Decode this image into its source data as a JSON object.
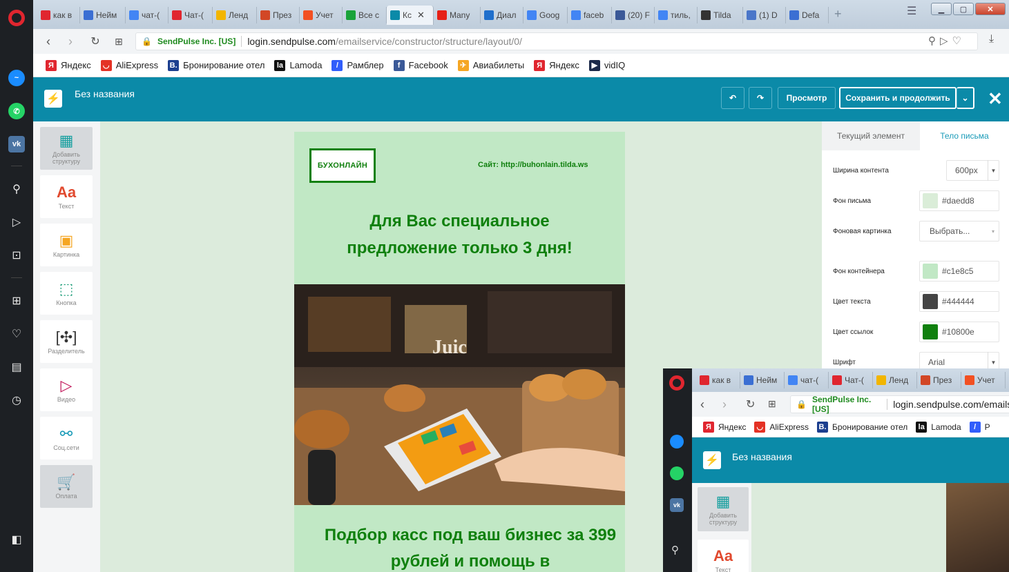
{
  "browser": {
    "tabs": [
      {
        "label": "как в",
        "icon": "yandex-icon",
        "color": "#e0262f"
      },
      {
        "label": "Нейм",
        "icon": "mail-icon",
        "color": "#3b6fd3"
      },
      {
        "label": "чат-(",
        "icon": "google-icon",
        "color": "#4285f4"
      },
      {
        "label": "Чат-(",
        "icon": "opera-icon",
        "color": "#e0262f"
      },
      {
        "label": "Ленд",
        "icon": "bulb-icon",
        "color": "#f2b500"
      },
      {
        "label": "През",
        "icon": "presentation-icon",
        "color": "#d24726"
      },
      {
        "label": "Учет",
        "icon": "grid-icon",
        "color": "#f25022"
      },
      {
        "label": "Все с",
        "icon": "square-icon",
        "color": "#1aa33a"
      },
      {
        "label": "Кс",
        "icon": "sendpulse-icon",
        "color": "#0b8aa8",
        "active": true
      },
      {
        "label": "Many",
        "icon": "youtube-icon",
        "color": "#e62117"
      },
      {
        "label": "Диал",
        "icon": "chat-icon",
        "color": "#1f6fcc"
      },
      {
        "label": "Goog",
        "icon": "translate-icon",
        "color": "#4285f4"
      },
      {
        "label": "faceb",
        "icon": "google-icon",
        "color": "#4285f4"
      },
      {
        "label": "(20) F",
        "icon": "facebook-icon",
        "color": "#3b5998"
      },
      {
        "label": "тиль,",
        "icon": "google-icon",
        "color": "#4285f4"
      },
      {
        "label": "Tilda",
        "icon": "tilda-icon",
        "color": "#333333"
      },
      {
        "label": "(1) D",
        "icon": "person-icon",
        "color": "#4a76c9"
      },
      {
        "label": "Defa",
        "icon": "flower-icon",
        "color": "#3b6fd3"
      }
    ],
    "url": {
      "cert": "SendPulse Inc. [US]",
      "host": "login.sendpulse.com",
      "path": "/emailservice/constructor/structure/layout/0/"
    },
    "bookmarks": [
      {
        "label": "Яндекс",
        "icon": "yandex-icon",
        "color": "#e0262f",
        "glyph": "Я"
      },
      {
        "label": "AliExpress",
        "icon": "aliexpress-icon",
        "color": "#e43225",
        "glyph": "◡"
      },
      {
        "label": "Бронирование отел",
        "icon": "booking-icon",
        "color": "#1c3f8f",
        "glyph": "B."
      },
      {
        "label": "Lamoda",
        "icon": "lamoda-icon",
        "color": "#111111",
        "glyph": "la"
      },
      {
        "label": "Рамблер",
        "icon": "rambler-icon",
        "color": "#315efb",
        "glyph": "/"
      },
      {
        "label": "Facebook",
        "icon": "facebook-icon",
        "color": "#3b5998",
        "glyph": "f"
      },
      {
        "label": "Авиабилеты",
        "icon": "plane-icon",
        "color": "#f5a623",
        "glyph": "✈"
      },
      {
        "label": "Яндекс",
        "icon": "yandex-icon",
        "color": "#e0262f",
        "glyph": "Я"
      },
      {
        "label": "vidIQ",
        "icon": "vidiq-icon",
        "color": "#1c2a4a",
        "glyph": "▶"
      }
    ]
  },
  "app": {
    "title": "Без названия",
    "preview": "Просмотр",
    "save": "Сохранить и продолжить",
    "undo_icon": "↶",
    "redo_icon": "↷",
    "close_icon": "✕"
  },
  "tools": [
    {
      "label": "Добавить структуру",
      "icon": "structure-icon",
      "glyph": "▦",
      "color": "#18a0a0",
      "selected": true
    },
    {
      "label": "Текст",
      "icon": "text-icon",
      "glyph": "Aa",
      "color": "#e14a2f"
    },
    {
      "label": "Картинка",
      "icon": "image-icon",
      "glyph": "▣",
      "color": "#f5a623"
    },
    {
      "label": "Кнопка",
      "icon": "button-icon",
      "glyph": "⬚",
      "color": "#1f9e7a"
    },
    {
      "label": "Разделитель",
      "icon": "divider-icon",
      "glyph": "[✣]",
      "color": "#333333"
    },
    {
      "label": "Видео",
      "icon": "video-icon",
      "glyph": "▷",
      "color": "#c2185b"
    },
    {
      "label": "Соц.сети",
      "icon": "share-icon",
      "glyph": "⚯",
      "color": "#1a9bb8"
    },
    {
      "label": "Оплата",
      "icon": "cart-icon",
      "glyph": "🛒",
      "color": "#f5a623",
      "selected": true
    }
  ],
  "email": {
    "brand": "БУХОНЛАЙН",
    "site": "Сайт: http://buhonlain.tilda.ws",
    "headline": "Для Вас специальное предложение только 3 дня!",
    "subline": "Подбор касс под ваш бизнес за 399 рублей и помощь в"
  },
  "props": {
    "tab_current": "Текущий элемент",
    "tab_body": "Тело письма",
    "fields": [
      {
        "label": "Ширина контента",
        "value": "600px",
        "kind": "select"
      },
      {
        "label": "Фон письма",
        "value": "#daedd8",
        "kind": "color",
        "color": "#daedd8"
      },
      {
        "label": "Фоновая картинка",
        "value": "Выбрать...",
        "kind": "button"
      },
      {
        "label": "Фон контейнера",
        "value": "#c1e8c5",
        "kind": "color",
        "color": "#c1e8c5"
      },
      {
        "label": "Цвет текста",
        "value": "#444444",
        "kind": "color",
        "color": "#444444"
      },
      {
        "label": "Цвет ссылок",
        "value": "#10800e",
        "kind": "color",
        "color": "#10800e"
      },
      {
        "label": "Шрифт",
        "value": "Arial",
        "kind": "select"
      }
    ]
  },
  "overlay": {
    "tabs": [
      "как в",
      "Нейм",
      "чат-(",
      "Чат-(",
      "Ленд",
      "През",
      "Учет"
    ],
    "cert": "SendPulse Inc. [US]",
    "url": "login.sendpulse.com/emailse",
    "bookmarks": [
      "Яндекс",
      "AliExpress",
      "Бронирование отел",
      "Lamoda",
      "Р"
    ],
    "app_title": "Без названия",
    "tool1": "Добавить структуру",
    "tool2_glyph": "Aa",
    "tool2_label": "Текст"
  }
}
